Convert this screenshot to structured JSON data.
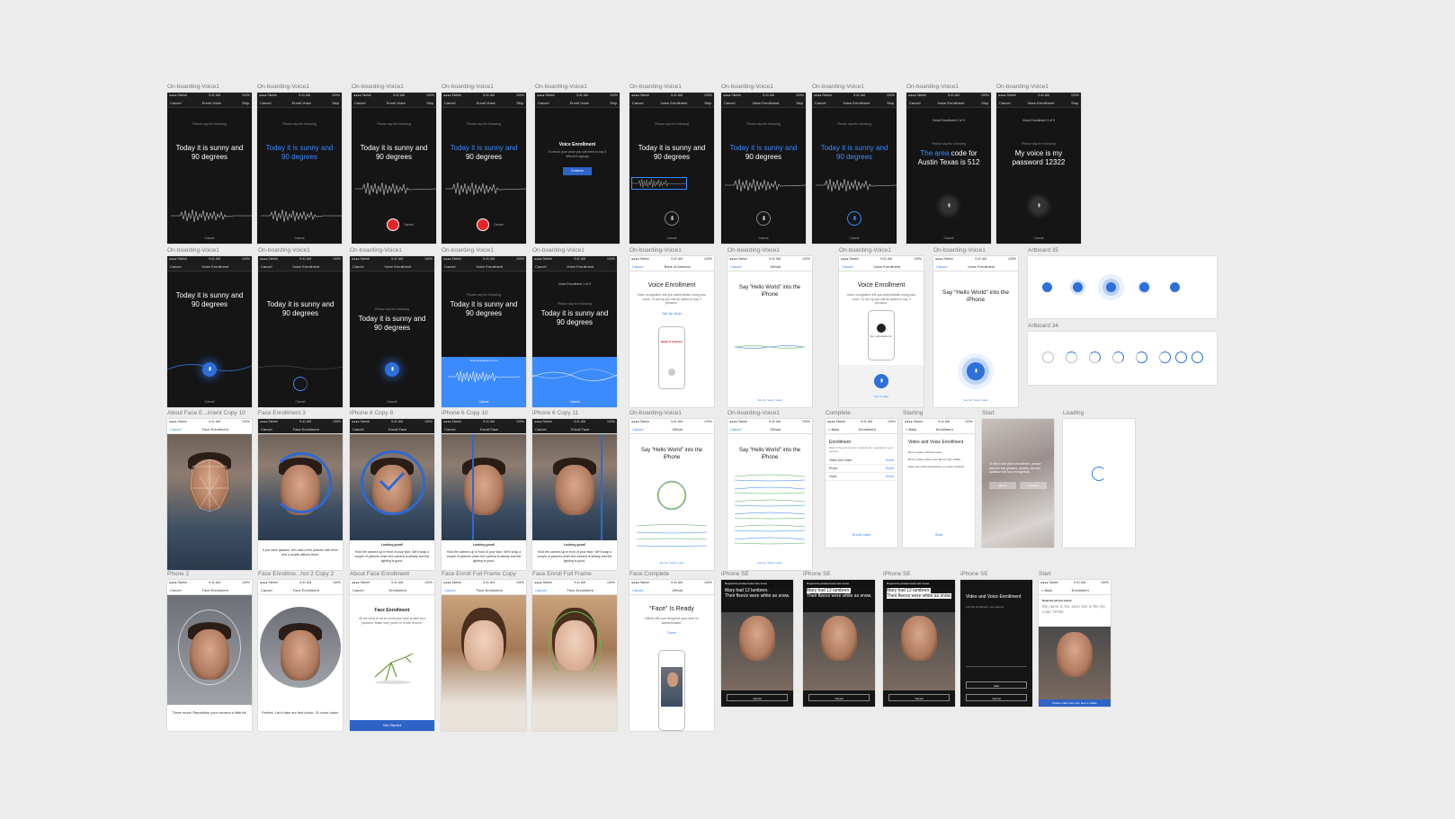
{
  "labels": {
    "onboarding": "On-boarding-Voice1",
    "artboard35": "Artboard 35",
    "artboard34": "Artboard 34",
    "about_face": "About Face E...iment Copy 10",
    "face_enroll3": "Face Enrollment 3",
    "iphone6_8": "iPhone 6 Copy 8",
    "iphone6_10": "iPhone 6 Copy 10",
    "iphone6_11": "iPhone 6 Copy 11",
    "complete": "Complete",
    "starting": "Starting",
    "start": "Start",
    "loading": "Loading",
    "phone2": "Phone 2",
    "face_enroll_hot": "Face Enrollme...hot 2 Copy 2",
    "about_face_enroll": "About Face Enrollment",
    "face_full_copy": "Face Enroll Full Frame Copy",
    "face_full": "Face Enroll Full Frame",
    "face_complete": "Face Complete",
    "iphone_se": "iPhone SE"
  },
  "common": {
    "status_left": "●●●● Sketch",
    "status_time": "9:41 AM",
    "status_right": "100%",
    "cancel": "Cancel",
    "skip": "Skip",
    "enroll_voice": "Enroll Voice",
    "voice_enrollment": "Voice Enrollment",
    "face_enrollment": "Face Enrollment",
    "enroll_face": "Enroll Face",
    "enrollment": "Enrollment",
    "please_say": "Please say the following",
    "back": "< Back"
  },
  "phrases": {
    "sunny": "Today it is sunny and 90 degrees",
    "sunny_hl": "Today it is sunny and",
    "sunny_rest": "90 degrees",
    "area_hl": "The area",
    "area_rest": "code for Austin Texas is 512",
    "voice_pw": "My voice is my password 12322",
    "hello_world": "Say “Hello World” into the iPhone",
    "voice_enroll_2of3": "Voice Enrollment 2 of 3",
    "voice_enroll_3of3": "Voice Enrollment 3 of 3",
    "voice_enroll_1of3": "Voice Enrollment 1 of 3"
  },
  "voice_enroll_dialog": {
    "title": "Voice Enrollment",
    "body": "To enroll your voice you will need to say 3 different sayings",
    "button": "Continue"
  },
  "bank": {
    "nav_title": "Bank of America",
    "title": "Voice Enrollment",
    "body": "Voice recognition lets you authenticate using your voice. To set up you will be asked to say 3 phrases.",
    "link": "Set Up Now"
  },
  "github": {
    "nav_title": "Github",
    "later": "Set Up “Voice” Later",
    "tap_start": "Tap To Start",
    "octocat": "Say “authenticate me”"
  },
  "face": {
    "caption_glasses": "If you wear glasses, let's take a few pictures with them and a couple without them.",
    "looking_good": "Looking good!",
    "hold_camera": "Hold the camera up in front of your face. We'll snap a couple of pictures when the camera is steady and the lighting is good.",
    "three_more": "Three more! Reposition your camera a little bit.",
    "perfect": "Perfect. Let's take our first photo. I'll count down.",
    "about_title": "Face Enrollment",
    "about_body": "All we need to do to enroll your face is take four pictures. Make sure you're in a well lit area.",
    "get_started": "Get Started",
    "ready_title": "“Face” Is Ready",
    "ready_body": "Github will now recognize your face for authentication.",
    "done": "Done"
  },
  "complete_screen": {
    "title": "Enrollment",
    "body": "Both of these biometric methods are required for your security.",
    "rows": [
      "Video and Voice",
      "Photo",
      "Voice"
    ],
    "enroll": "Enroll",
    "later": "Enroll Later"
  },
  "starting_screen": {
    "title": "Video and Voice Enrollment",
    "tips": [
      "Be in a place with low noise.",
      "Be in a place where your face is fully visible.",
      "Wear any head accessories you wear routinely."
    ],
    "start": "Start"
  },
  "start_blur": {
    "body": "To finish the video enrollment, please remove any glasses, jewelry, etc and continue the face recognition.",
    "ignore": "Ignore",
    "continue": "Continue"
  },
  "se": {
    "repeat": "Repeat the phrase below two times",
    "mary1": "Mary had 12 lambren.",
    "mary2": "Their fleece were white as snow.",
    "cancel": "Cancel",
    "video_title": "Video and Voice Enrollment",
    "video_body": "For this enrollment, you need to:",
    "start": "Start",
    "read_phrase": "Read the phrase below",
    "tai": "My name is Tai, and I live in the zip code 78758",
    "bottom_bar": "Please make sure your face is visible"
  }
}
